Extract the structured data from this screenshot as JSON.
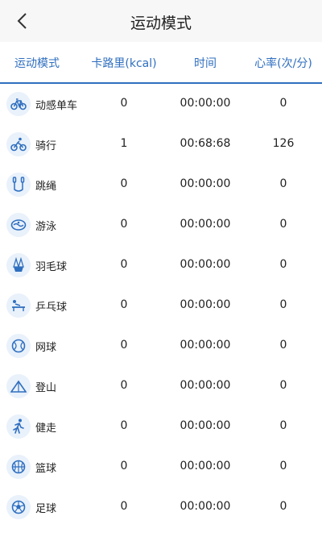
{
  "nav": {
    "title": "运动模式"
  },
  "columns": [
    "运动模式",
    "卡路里(kcal)",
    "时间",
    "心率(次/分)"
  ],
  "rows": [
    {
      "icon": "bicycle-icon",
      "name": "动感单车",
      "kcal": "0",
      "time": "00:00:00",
      "hr": "0"
    },
    {
      "icon": "cycling-icon",
      "name": "骑行",
      "kcal": "1",
      "time": "00:68:68",
      "hr": "126"
    },
    {
      "icon": "jump-rope-icon",
      "name": "跳绳",
      "kcal": "0",
      "time": "00:00:00",
      "hr": "0"
    },
    {
      "icon": "swimming-icon",
      "name": "游泳",
      "kcal": "0",
      "time": "00:00:00",
      "hr": "0"
    },
    {
      "icon": "badminton-icon",
      "name": "羽毛球",
      "kcal": "0",
      "time": "00:00:00",
      "hr": "0"
    },
    {
      "icon": "table-tennis-icon",
      "name": "乒乓球",
      "kcal": "0",
      "time": "00:00:00",
      "hr": "0"
    },
    {
      "icon": "tennis-icon",
      "name": "网球",
      "kcal": "0",
      "time": "00:00:00",
      "hr": "0"
    },
    {
      "icon": "mountain-icon",
      "name": "登山",
      "kcal": "0",
      "time": "00:00:00",
      "hr": "0"
    },
    {
      "icon": "walking-icon",
      "name": "健走",
      "kcal": "0",
      "time": "00:00:00",
      "hr": "0"
    },
    {
      "icon": "basketball-icon",
      "name": "篮球",
      "kcal": "0",
      "time": "00:00:00",
      "hr": "0"
    },
    {
      "icon": "soccer-icon",
      "name": "足球",
      "kcal": "0",
      "time": "00:00:00",
      "hr": "0"
    }
  ],
  "colors": {
    "accent": "#2f6fbf",
    "icon_bg": "#e9f1fb",
    "nav_bg": "#f7f7f7"
  }
}
